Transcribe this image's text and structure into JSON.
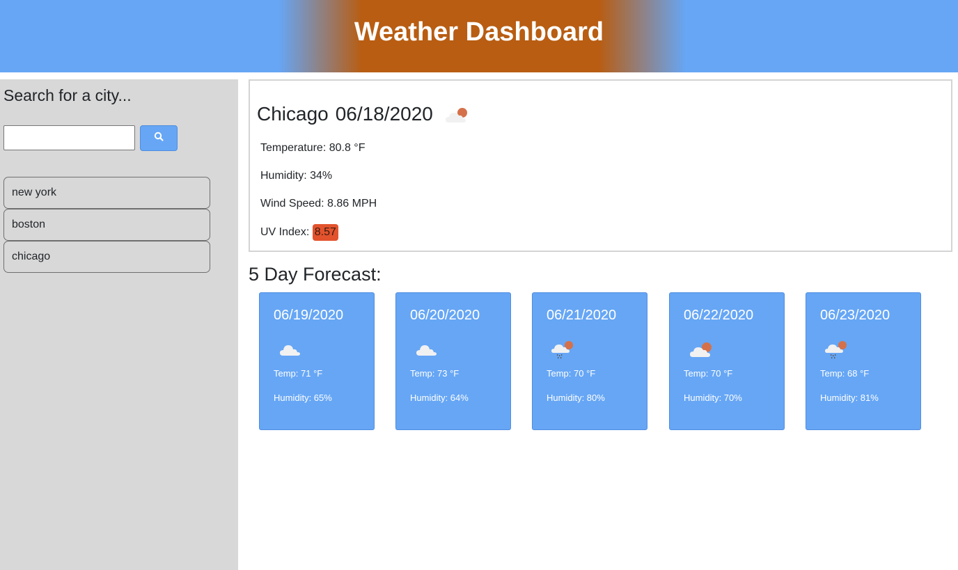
{
  "header": {
    "title": "Weather Dashboard"
  },
  "colors": {
    "header_blue": "#66a6f5",
    "header_orange": "#b85d12",
    "card_blue": "#66a6f5",
    "uv_severe": "#e2532d",
    "sidebar_bg": "#d8d8d8"
  },
  "sidebar": {
    "heading": "Search for a city...",
    "search": {
      "value": "",
      "placeholder": ""
    },
    "search_button_icon": "search-icon",
    "history": [
      {
        "label": "new york"
      },
      {
        "label": "boston"
      },
      {
        "label": "chicago"
      }
    ]
  },
  "current": {
    "city": "Chicago",
    "date": "06/18/2020",
    "icon": "partly-cloudy-icon",
    "temperature": "Temperature: 80.8 °F",
    "humidity": "Humidity: 34%",
    "wind": "Wind Speed: 8.86 MPH",
    "uv_label": "UV Index:",
    "uv_value": "8.57"
  },
  "forecast": {
    "title": "5 Day Forecast:",
    "days": [
      {
        "date": "06/19/2020",
        "icon": "cloud-icon",
        "temp": "Temp: 71 °F",
        "humidity": "Humidity: 65%"
      },
      {
        "date": "06/20/2020",
        "icon": "cloud-icon",
        "temp": "Temp: 73 °F",
        "humidity": "Humidity: 64%"
      },
      {
        "date": "06/21/2020",
        "icon": "rain-sun-icon",
        "temp": "Temp: 70 °F",
        "humidity": "Humidity: 80%"
      },
      {
        "date": "06/22/2020",
        "icon": "partly-cloudy-icon",
        "temp": "Temp: 70 °F",
        "humidity": "Humidity: 70%"
      },
      {
        "date": "06/23/2020",
        "icon": "rain-sun-icon",
        "temp": "Temp: 68 °F",
        "humidity": "Humidity: 81%"
      }
    ]
  }
}
